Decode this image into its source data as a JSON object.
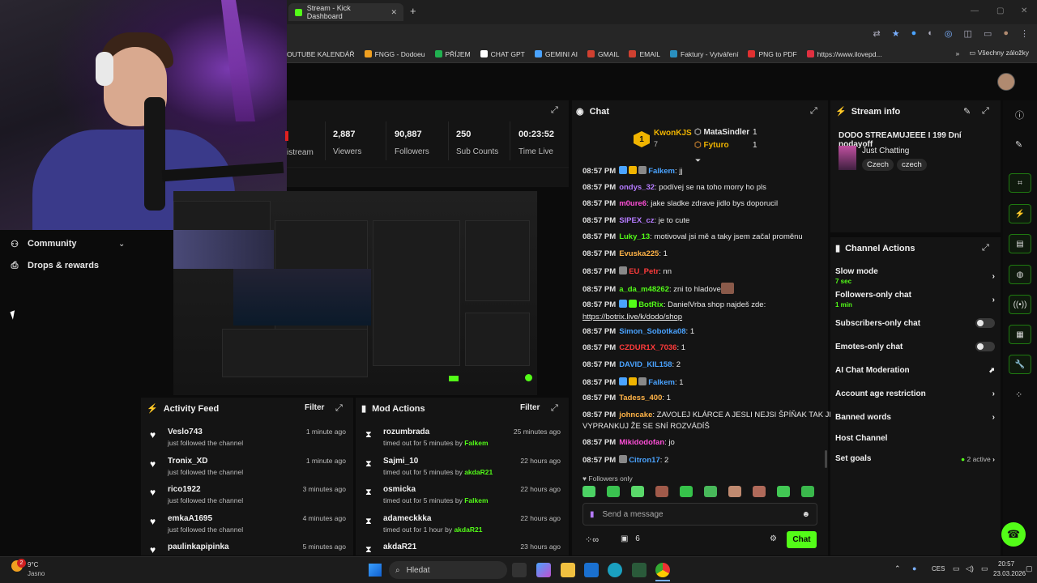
{
  "browser": {
    "tab_title": "Stream - Kick Dashboard",
    "tab_close": "✕",
    "new_tab": "+",
    "bookmarks": [
      "OUTUBE KALENDÁŘ",
      "FNGG - Dodoeu",
      "PŘÍJEM",
      "CHAT GPT",
      "GEMINI AI",
      "GMAIL",
      "EMAIL",
      "Faktury - Vytváření",
      "PNG to PDF",
      "https://www.ilovepd..."
    ],
    "bookmarks_more": "»",
    "all_bookmarks": "Všechny záložky"
  },
  "sidebar": {
    "community": "Community",
    "drops": "Drops & rewards"
  },
  "stats": {
    "stream_label": "istream",
    "items": [
      {
        "value": "2,887",
        "label": "Viewers"
      },
      {
        "value": "90,887",
        "label": "Followers"
      },
      {
        "value": "250",
        "label": "Sub Counts"
      },
      {
        "value": "00:23:52",
        "label": "Time Live"
      }
    ]
  },
  "activity": {
    "title": "Activity Feed",
    "filter": "Filter",
    "items": [
      {
        "name": "Veslo743",
        "sub": "just followed the channel",
        "time": "1 minute ago"
      },
      {
        "name": "Tronix_XD",
        "sub": "just followed the channel",
        "time": "1 minute ago"
      },
      {
        "name": "rico1922",
        "sub": "just followed the channel",
        "time": "3 minutes ago"
      },
      {
        "name": "emkaA1695",
        "sub": "just followed the channel",
        "time": "4 minutes ago"
      },
      {
        "name": "paulinkapipinka",
        "sub": "",
        "time": "5 minutes ago"
      }
    ]
  },
  "mod": {
    "title": "Mod Actions",
    "filter": "Filter",
    "by": "by",
    "items": [
      {
        "name": "rozumbrada",
        "action": "timed out for 5 minutes",
        "mod": "Falkem",
        "time": "25 minutes ago"
      },
      {
        "name": "Sajmi_10",
        "action": "timed out for 5 minutes",
        "mod": "akdaR21",
        "time": "22 hours ago"
      },
      {
        "name": "osmicka",
        "action": "timed out for 5 minutes",
        "mod": "Falkem",
        "time": "22 hours ago"
      },
      {
        "name": "adameckkka",
        "action": "timed out for 1 hour",
        "mod": "akdaR21",
        "time": "22 hours ago"
      },
      {
        "name": "akdaR21",
        "action": "",
        "mod": "",
        "time": "23 hours ago"
      }
    ]
  },
  "chat": {
    "title": "Chat",
    "leaders": [
      {
        "rank": "1",
        "name": "KwonKJS",
        "count": "7"
      },
      {
        "name": "MataSindler",
        "count": "1"
      },
      {
        "name": "Fyturo",
        "count": "1"
      }
    ],
    "messages": [
      {
        "time": "08:57 PM",
        "user": "Falkem",
        "color": "#4aa3ff",
        "text": ": jj"
      },
      {
        "time": "08:57 PM",
        "user": "ondys_32",
        "color": "#b57bff",
        "text": ": podívej se na toho morry ho pls"
      },
      {
        "time": "08:57 PM",
        "user": "m0ure6",
        "color": "#ff4fd8",
        "text": ": jake sladke zdrave jidlo bys doporucil"
      },
      {
        "time": "08:57 PM",
        "user": "SIPEX_cz",
        "color": "#b57bff",
        "text": ": je to cute"
      },
      {
        "time": "08:57 PM",
        "user": "Luky_13",
        "color": "#53fc18",
        "text": ": motivoval jsi mě a taky jsem začal proměnu"
      },
      {
        "time": "08:57 PM",
        "user": "Evuska225",
        "color": "#ffb347",
        "text": ": 1"
      },
      {
        "time": "08:57 PM",
        "user": "EU_Petr",
        "color": "#ff3b3b",
        "text": ": nn"
      },
      {
        "time": "08:57 PM",
        "user": "a_da_m48262",
        "color": "#53fc18",
        "text": ": zni to hladove"
      },
      {
        "time": "08:57 PM",
        "user": "BotRix",
        "color": "#53fc18",
        "text": ": DanielVrba shop najdeš zde:"
      },
      {
        "time": "08:57 PM",
        "user": "Simon_Sobotka08",
        "color": "#4aa3ff",
        "text": ": 1"
      },
      {
        "time": "08:57 PM",
        "user": "CZDUR1X_7036",
        "color": "#ff3b3b",
        "text": ": 1"
      },
      {
        "time": "08:57 PM",
        "user": "DAVID_KIL158",
        "color": "#4aa3ff",
        "text": ": 2"
      },
      {
        "time": "08:57 PM",
        "user": "Falkem",
        "color": "#4aa3ff",
        "text": ": 1"
      },
      {
        "time": "08:57 PM",
        "user": "Tadess_400",
        "color": "#ffb347",
        "text": ": 1"
      },
      {
        "time": "08:57 PM",
        "user": "johncake",
        "color": "#ffb347",
        "text": ": ZAVOLEJ KLÁRCE A JESLI NEJSI ŠPÍŇAK TAK JI"
      },
      {
        "time": "08:57 PM",
        "user": "Mikidodofan",
        "color": "#ff4fd8",
        "text": ": jo"
      },
      {
        "time": "08:57 PM",
        "user": "Citron17",
        "color": "#4aa3ff",
        "text": ": 2"
      }
    ],
    "link": "https://botrix.live/k/dodo/shop",
    "cont": "VYPRANKUJ ŽE SE SNÍ ROZVÁDÍŠ",
    "followers_only": "Followers only",
    "placeholder": "Send a message",
    "count": "6",
    "send": "Chat"
  },
  "info": {
    "title": "Stream info",
    "stream_title": "DODO STREAMUJEEE I 199 Dní nodayoff",
    "category": "Just Chatting",
    "tags": [
      "Czech",
      "czech"
    ]
  },
  "actions": {
    "title": "Channel Actions",
    "slow": "Slow mode",
    "slow_sub": "7 sec",
    "followers": "Followers-only chat",
    "followers_sub": "1 min",
    "subs": "Subscribers-only chat",
    "emotes": "Emotes-only chat",
    "ai": "AI Chat Moderation",
    "age": "Account age restriction",
    "banned": "Banned words",
    "host": "Host Channel",
    "goals": "Set goals",
    "goals_status": "2 active"
  },
  "taskbar": {
    "weather_temp": "9°C",
    "weather_desc": "Jasno",
    "search": "Hledat",
    "lang": "CES",
    "time": "20:57",
    "date": "23.03.2026",
    "weather_badge": "2"
  }
}
